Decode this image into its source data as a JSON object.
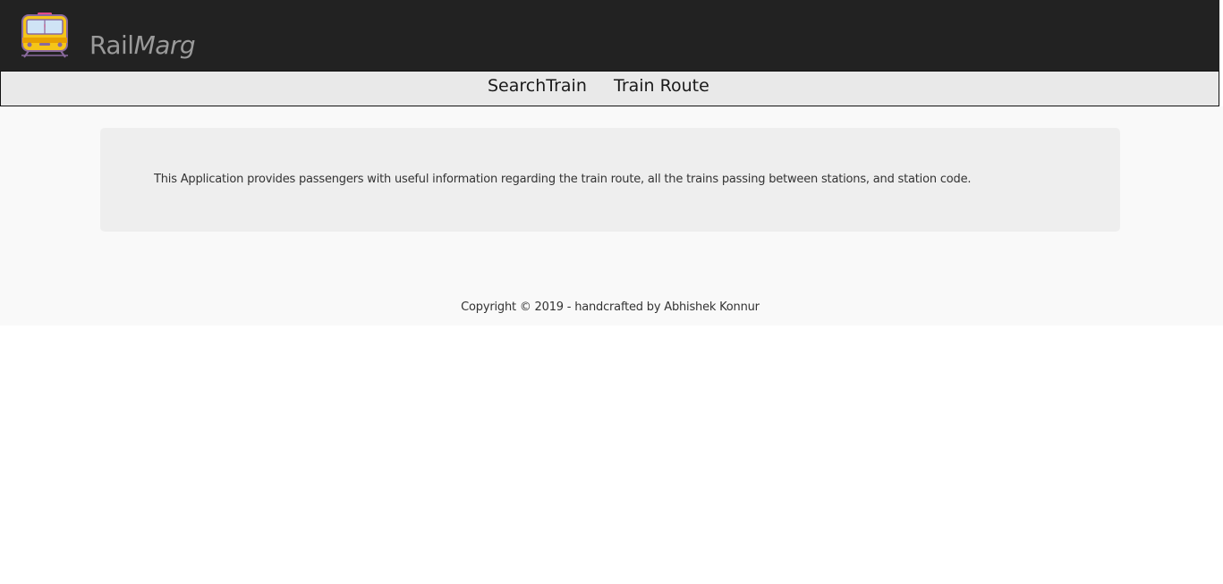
{
  "header": {
    "brand_plain": "Rail",
    "brand_italic": "Marg",
    "logo_icon": "train-front-icon",
    "background_color": "#222222",
    "brand_color": "#9a9a9a"
  },
  "nav": {
    "items": [
      {
        "label": "SearchTrain"
      },
      {
        "label": "Train Route"
      }
    ]
  },
  "main": {
    "info_text": "This Application provides passengers with useful information regarding the train route, all the trains passing between stations, and station code."
  },
  "footer": {
    "copyright": "Copyright © 2019 - handcrafted by Abhishek Konnur"
  }
}
